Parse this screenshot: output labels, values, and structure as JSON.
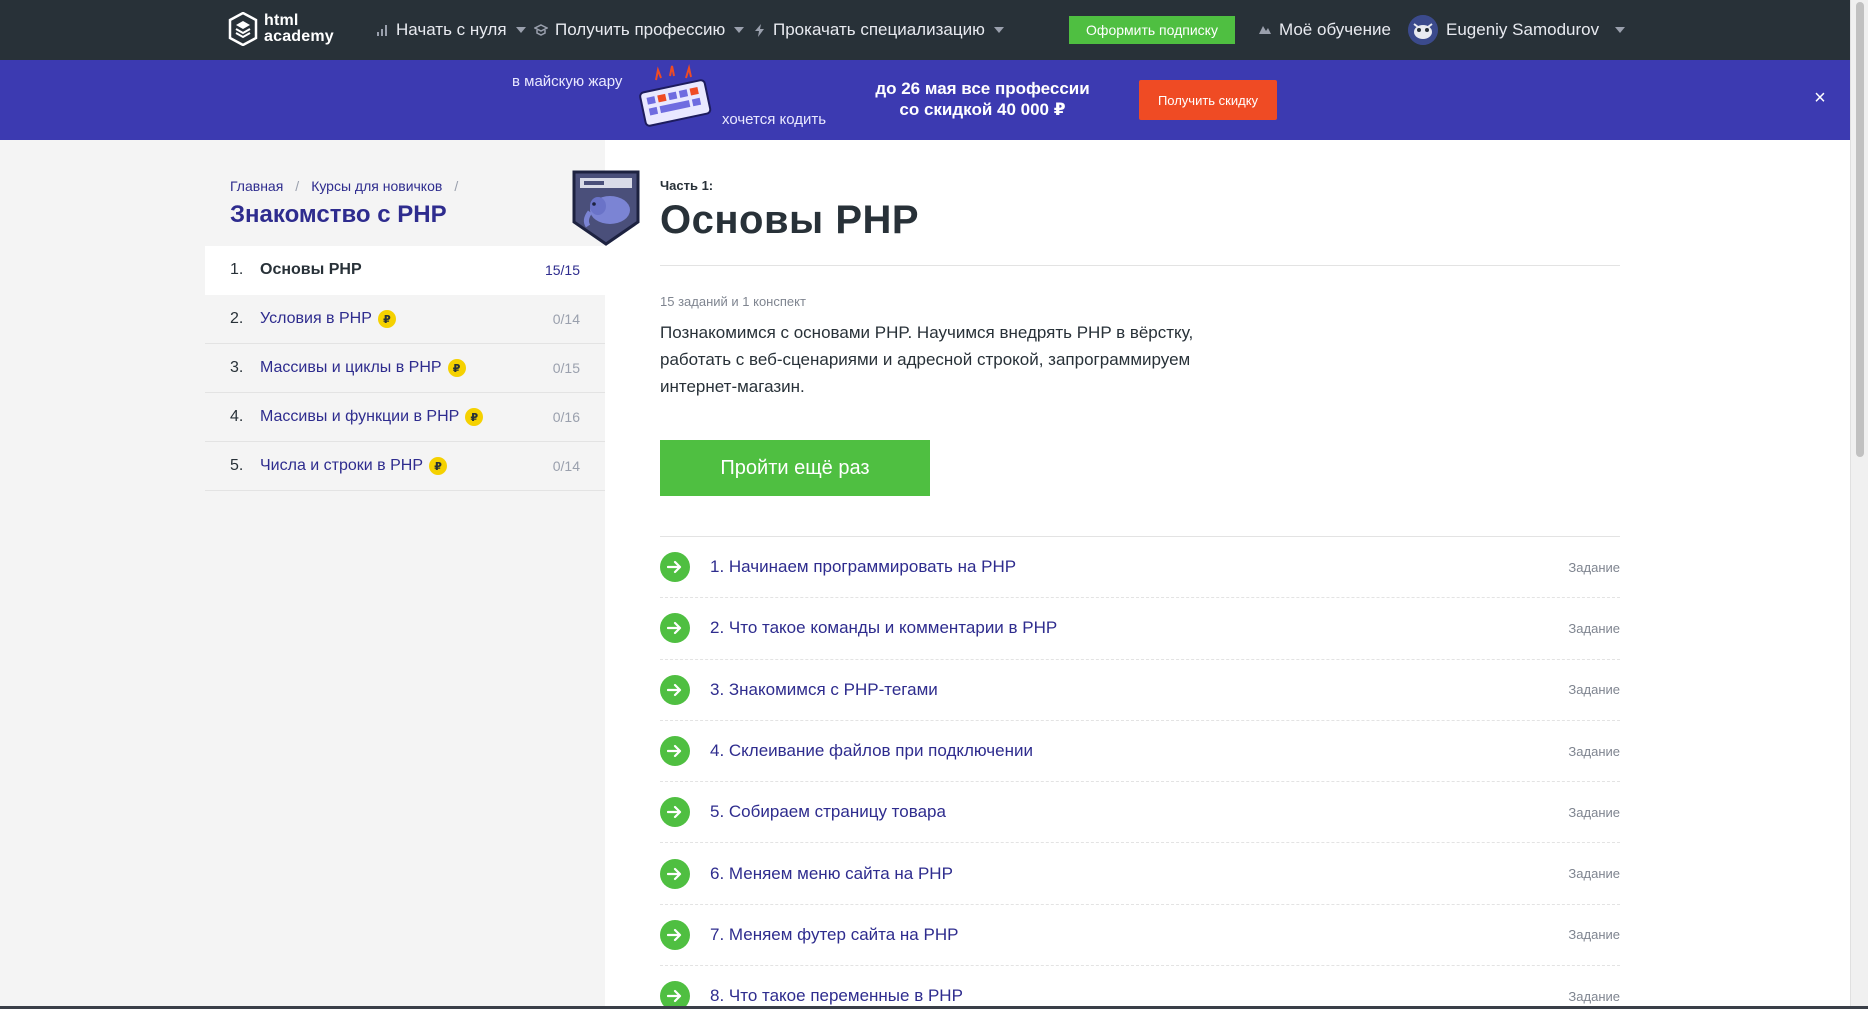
{
  "header": {
    "logo_line1": "html",
    "logo_line2": "academy",
    "nav": [
      {
        "label": "Начать с нуля",
        "icon": "bar-chart-icon"
      },
      {
        "label": "Получить профессию",
        "icon": "graduation-cap-icon"
      },
      {
        "label": "Прокачать специализацию",
        "icon": "lightning-icon"
      }
    ],
    "subscribe_label": "Оформить подписку",
    "my_learning_label": "Моё обучение",
    "user_name": "Eugeniy Samodurov"
  },
  "promo": {
    "text_top": "в майскую жару",
    "text_bottom": "хочется кодить",
    "main_line1": "до 26 мая все профессии",
    "main_line2": "со скидкой 40 000 ₽",
    "button_label": "Получить скидку",
    "close_label": "×"
  },
  "sidebar": {
    "breadcrumb": [
      "Главная",
      "Курсы для новичков"
    ],
    "breadcrumb_sep": "/",
    "course_title": "Знакомство с PHP",
    "chapters": [
      {
        "num": "1.",
        "label": "Основы PHP",
        "count": "15/15",
        "paid": false,
        "active": true
      },
      {
        "num": "2.",
        "label": "Условия в PHP",
        "count": "0/14",
        "paid": true,
        "active": false
      },
      {
        "num": "3.",
        "label": "Массивы и циклы в PHP",
        "count": "0/15",
        "paid": true,
        "active": false
      },
      {
        "num": "4.",
        "label": "Массивы и функции в PHP",
        "count": "0/16",
        "paid": true,
        "active": false
      },
      {
        "num": "5.",
        "label": "Числа и строки в PHP",
        "count": "0/14",
        "paid": true,
        "active": false
      }
    ],
    "coin_symbol": "₽"
  },
  "main": {
    "part_label": "Часть 1:",
    "title": "Основы PHP",
    "meta": "15 заданий и 1 конспект",
    "description": "Познакомимся с основами PHP. Научимся внедрять PHP в вёрстку, работать с веб-сценариями и адресной строкой, запрограммируем интернет-магазин.",
    "retry_label": "Пройти ещё раз",
    "tasks": [
      {
        "label": "1. Начинаем программировать на PHP",
        "type": "Задание"
      },
      {
        "label": "2. Что такое команды и комментарии в PHP",
        "type": "Задание"
      },
      {
        "label": "3. Знакомимся с PHP-тегами",
        "type": "Задание"
      },
      {
        "label": "4. Склеивание файлов при подключении",
        "type": "Задание"
      },
      {
        "label": "5. Собираем страницу товара",
        "type": "Задание"
      },
      {
        "label": "6. Меняем меню сайта на PHP",
        "type": "Задание"
      },
      {
        "label": "7. Меняем футер сайта на PHP",
        "type": "Задание"
      },
      {
        "label": "8. Что такое переменные в PHP",
        "type": "Задание"
      }
    ]
  },
  "colors": {
    "nav_bg": "#283138",
    "promo_bg": "#3c3ab1",
    "accent_green": "#4fbf41",
    "accent_orange": "#ef4b24",
    "link_blue": "#2e2c8e",
    "coin_yellow": "#f5d100"
  }
}
